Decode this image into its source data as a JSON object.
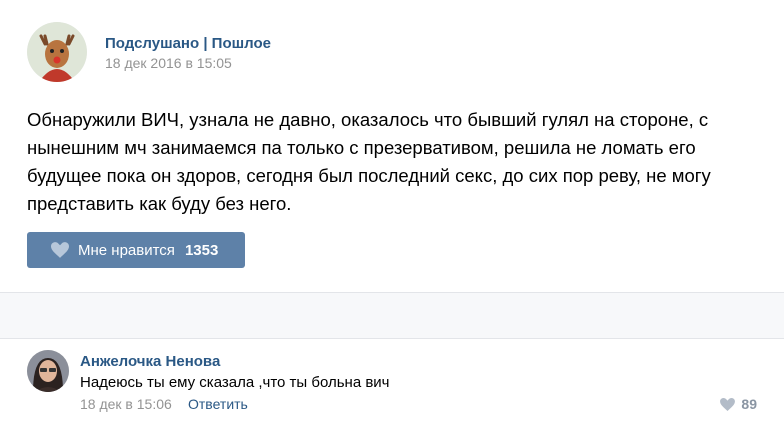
{
  "post": {
    "group_name": "Подслушано | Пошлое",
    "date": "18 дек 2016 в 15:05",
    "text": "Обнаружили ВИЧ, узнала не давно, оказалось что бывший гулял на стороне, с\nнынешним мч занимаемся па только с презервативом, решила не ломать его\nбудущее пока он здоров, сегодня был последний секс, до сих пор реву, не могу\nпредставить как буду без него.",
    "like_label": "Мне нравится",
    "like_count": "1353"
  },
  "comment": {
    "author": "Анжелочка Ненова",
    "text": "Надеюсь ты ему сказала ,что ты больна вич",
    "date": "18 дек в 15:06",
    "reply_label": "Ответить",
    "like_count": "89"
  },
  "colors": {
    "link": "#2a5885",
    "like_button_bg": "#5e81a8",
    "meta_text": "#939393"
  },
  "icons": {
    "group_avatar": "reindeer-avatar",
    "user_avatar": "profile-photo",
    "like": "heart-icon"
  }
}
